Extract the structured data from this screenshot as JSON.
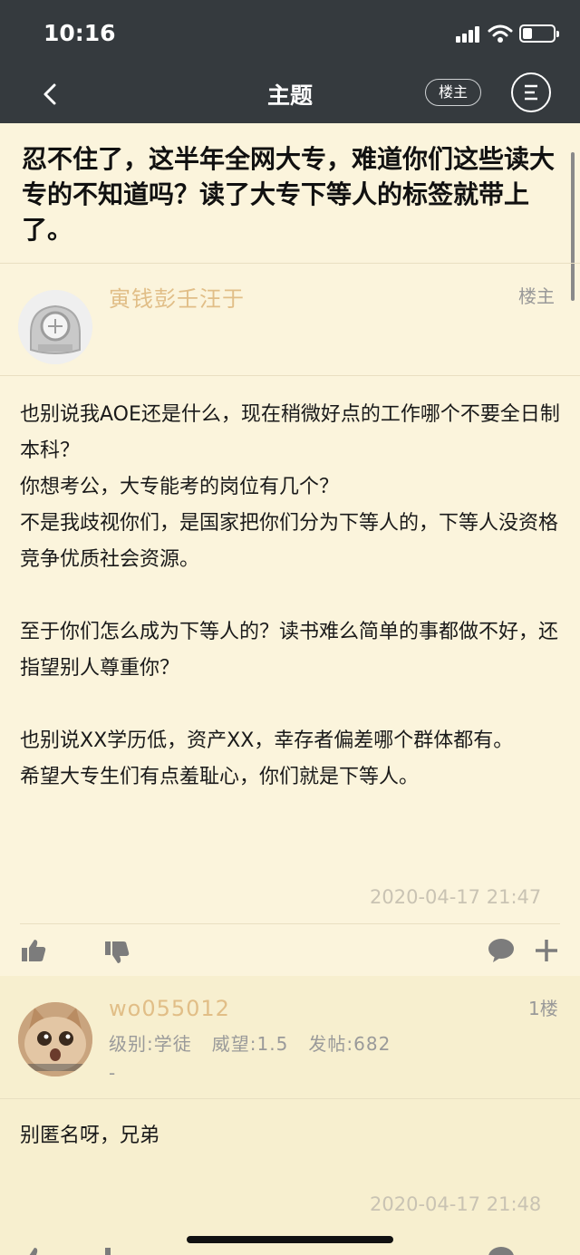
{
  "status_bar": {
    "time": "10:16"
  },
  "nav": {
    "title": "主题",
    "op_filter_label": "楼主"
  },
  "thread": {
    "title": "忍不住了，这半年全网大专，难道你们这些读大专的不知道吗？读了大专下等人的标签就带上了。"
  },
  "op_post": {
    "username": "寅钱彭壬汪于",
    "floor_label": "楼主",
    "paragraphs": [
      "也别说我AOE还是什么，现在稍微好点的工作哪个不要全日制本科？",
      "你想考公，大专能考的岗位有几个？",
      "不是我歧视你们，是国家把你们分为下等人的，下等人没资格竞争优质社会资源。",
      "",
      "至于你们怎么成为下等人的？读书难么简单的事都做不好，还指望别人尊重你？",
      "",
      "也别说XX学历低，资产XX，幸存者偏差哪个群体都有。",
      "希望大专生们有点羞耻心，你们就是下等人。"
    ],
    "timestamp": "2020-04-17 21:47"
  },
  "reply_1": {
    "username": "wo055012",
    "floor_label": "1楼",
    "meta": "级别:学徒   威望:1.5   发帖:682",
    "signature": "-",
    "text": "别匿名呀，兄弟",
    "timestamp": "2020-04-17 21:48"
  },
  "icons": {
    "back": "chevron-left-icon",
    "menu": "menu-lines-icon",
    "like": "thumbs-up-icon",
    "dislike": "thumbs-down-icon",
    "comment": "comment-bubble-icon",
    "add": "plus-icon"
  },
  "colors": {
    "header_bg": "#353a3e",
    "page_bg": "#fbf4dc",
    "reply_bg": "#f7efcf",
    "username": "#e1be87",
    "timestamp": "#c9c3b3"
  }
}
